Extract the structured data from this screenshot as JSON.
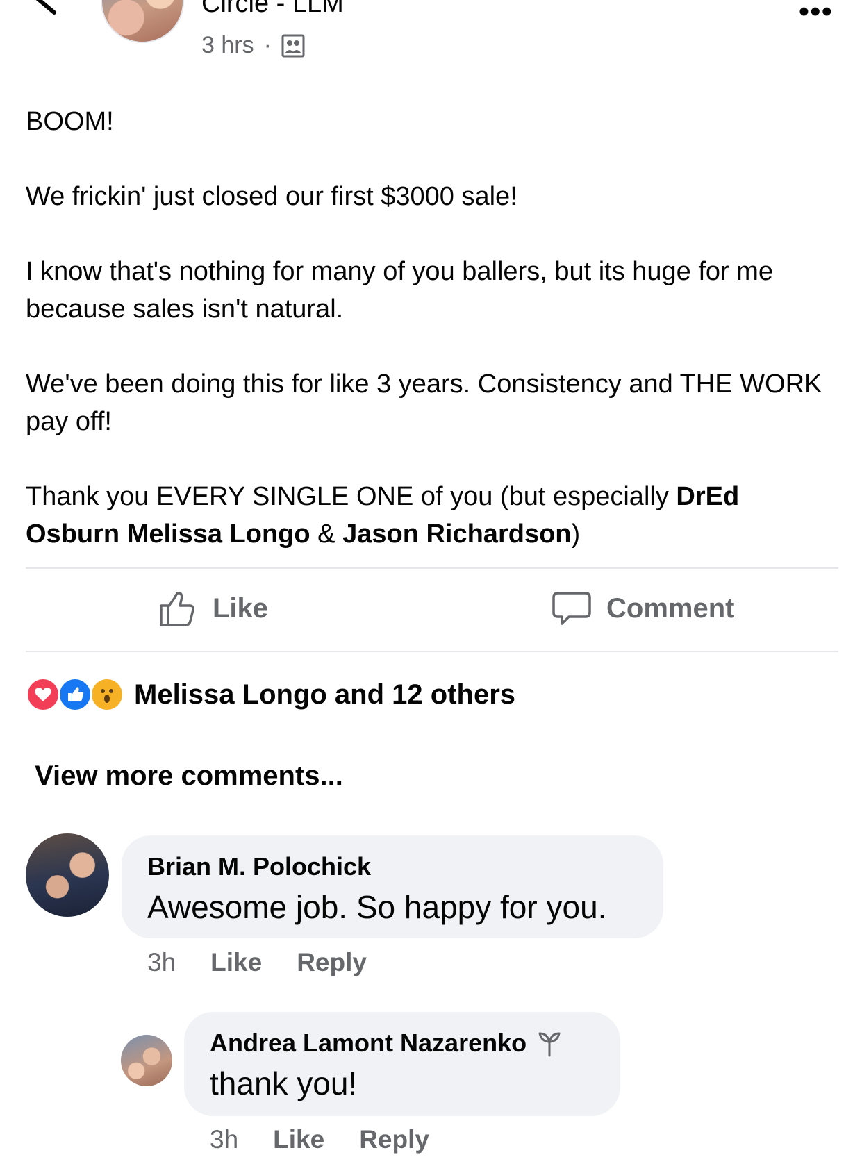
{
  "header": {
    "group_name": "Circle - LLM",
    "timestamp": "3 hrs",
    "separator": "·",
    "privacy_icon": "group-members-icon",
    "more_icon": "more-dots-icon",
    "more_glyph": "•••"
  },
  "post": {
    "paragraphs": [
      "BOOM!",
      "We frickin' just closed our first $3000 sale!",
      "I know that's nothing for many of you ballers, but its huge for me because sales isn't natural.",
      "We've been doing this for like 3 years. Consistency and THE WORK pay off!"
    ],
    "thanks": {
      "prefix": "Thank you EVERY SINGLE ONE of you (but especially ",
      "mention_1": "DrEd Osburn",
      "space": " ",
      "mention_2": "Melissa Longo",
      "amp": " & ",
      "mention_3": "Jason Richardson",
      "suffix": ")"
    }
  },
  "actions": {
    "like_label": "Like",
    "comment_label": "Comment"
  },
  "reactions": {
    "icons": [
      "love-reaction-icon",
      "like-reaction-icon",
      "wow-reaction-icon"
    ],
    "summary": "Melissa Longo and 12 others"
  },
  "comments_section": {
    "view_more": "View more comments..."
  },
  "comments": [
    {
      "author": "Brian M. Polochick",
      "text": "Awesome job.  So happy for you.",
      "time": "3h",
      "like": "Like",
      "reply": "Reply"
    },
    {
      "author": "Andrea Lamont Nazarenko",
      "badge_icon": "rising-star-badge-icon",
      "text": "thank you!",
      "time": "3h",
      "like": "Like",
      "reply": "Reply"
    }
  ],
  "colors": {
    "text_primary": "#050505",
    "text_secondary": "#65676b",
    "bubble_bg": "#f0f2f5",
    "divider": "#e4e6eb",
    "love": "#f33e58",
    "like": "#1877f2",
    "wow": "#f7b125"
  }
}
